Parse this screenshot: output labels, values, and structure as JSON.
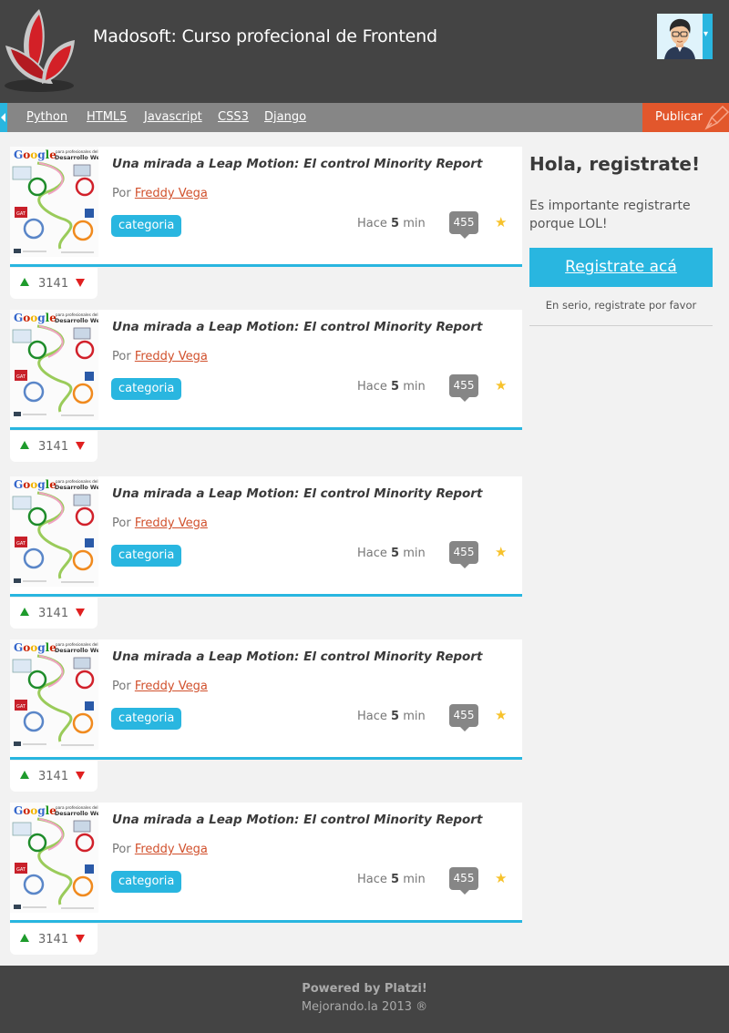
{
  "header": {
    "title": "Madosoft: Curso profecional de Frontend",
    "avatar_icon": "user-avatar",
    "avatar_caret": "▾"
  },
  "nav": {
    "links": [
      "Python",
      "HTML5",
      "Javascript",
      "CSS3",
      "Django"
    ],
    "publish_label": "Publicar"
  },
  "posts": [
    {
      "title": "Una mirada a Leap Motion: El control Minority Report",
      "by": "Por",
      "author": "Freddy Vega",
      "category": "categoria",
      "time_prefix": "Hace",
      "time_value": "5",
      "time_unit": "min",
      "comments": "455",
      "votes": "3141"
    },
    {
      "title": "Una mirada a Leap Motion: El control Minority Report",
      "by": "Por",
      "author": "Freddy Vega",
      "category": "categoria",
      "time_prefix": "Hace",
      "time_value": "5",
      "time_unit": "min",
      "comments": "455",
      "votes": "3141"
    },
    {
      "title": "Una mirada a Leap Motion: El control Minority Report",
      "by": "Por",
      "author": "Freddy Vega",
      "category": "categoria",
      "time_prefix": "Hace",
      "time_value": "5",
      "time_unit": "min",
      "comments": "455",
      "votes": "3141"
    },
    {
      "title": "Una mirada a Leap Motion: El control Minority Report",
      "by": "Por",
      "author": "Freddy Vega",
      "category": "categoria",
      "time_prefix": "Hace",
      "time_value": "5",
      "time_unit": "min",
      "comments": "455",
      "votes": "3141"
    },
    {
      "title": "Una mirada a Leap Motion: El control Minority Report",
      "by": "Por",
      "author": "Freddy Vega",
      "category": "categoria",
      "time_prefix": "Hace",
      "time_value": "5",
      "time_unit": "min",
      "comments": "455",
      "votes": "3141"
    }
  ],
  "thumbnail": {
    "brand": "Google",
    "line1": "para profesionales del",
    "line2": "Desarrollo Web"
  },
  "sidebar": {
    "title": "Hola, registrate!",
    "text": "Es importante registrarte porque LOL!",
    "button": "Registrate acá",
    "note": "En serio, registrate por favor"
  },
  "footer": {
    "powered": "Powered by Platzi!",
    "copyright": "Mejorando.la 2013 ®"
  },
  "colors": {
    "header_bg": "#444444",
    "nav_bg": "#868686",
    "accent": "#29b6e0",
    "publish": "#e2572c",
    "author_link": "#d1502c",
    "star": "#f7c22b",
    "vote_up": "#1e9b2c",
    "vote_down": "#e02020"
  }
}
